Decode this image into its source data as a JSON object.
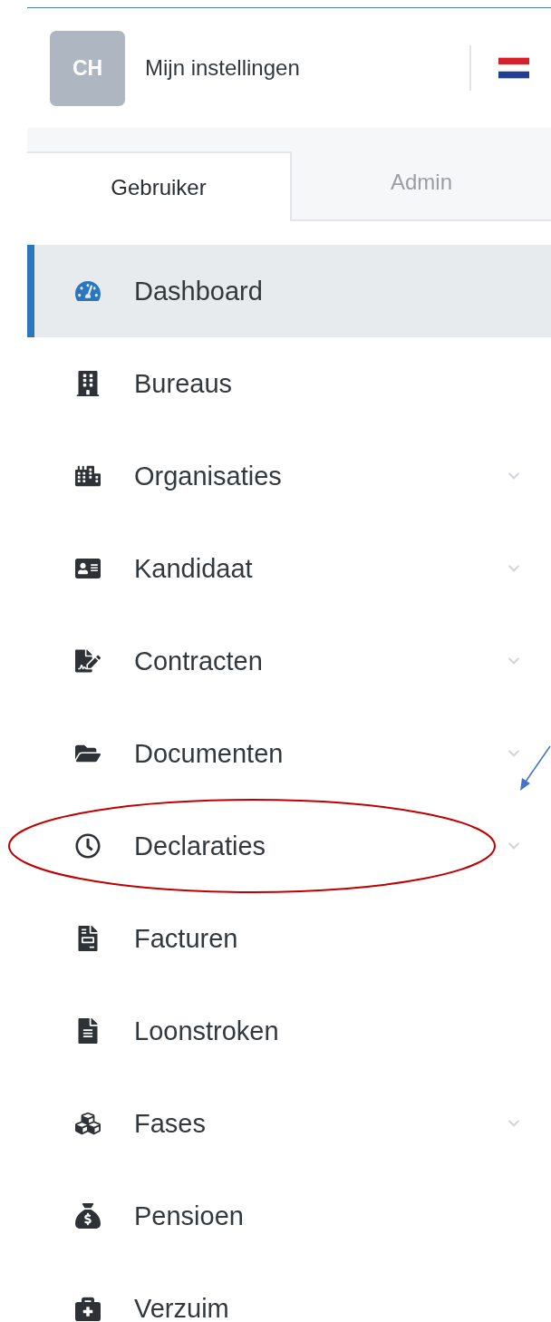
{
  "header": {
    "avatar": "CH",
    "title": "Mijn instellingen"
  },
  "tabs": [
    {
      "label": "Gebruiker",
      "selected": true
    },
    {
      "label": "Admin",
      "selected": false
    }
  ],
  "nav": [
    {
      "label": "Dashboard",
      "selected": true,
      "expandable": false,
      "circled": false
    },
    {
      "label": "Bureaus",
      "selected": false,
      "expandable": false,
      "circled": false
    },
    {
      "label": "Organisaties",
      "selected": false,
      "expandable": true,
      "circled": false
    },
    {
      "label": "Kandidaat",
      "selected": false,
      "expandable": true,
      "circled": false
    },
    {
      "label": "Contracten",
      "selected": false,
      "expandable": true,
      "circled": false
    },
    {
      "label": "Documenten",
      "selected": false,
      "expandable": true,
      "circled": false
    },
    {
      "label": "Declaraties",
      "selected": false,
      "expandable": true,
      "circled": true
    },
    {
      "label": "Facturen",
      "selected": false,
      "expandable": false,
      "circled": false
    },
    {
      "label": "Loonstroken",
      "selected": false,
      "expandable": false,
      "circled": false
    },
    {
      "label": "Fases",
      "selected": false,
      "expandable": true,
      "circled": false
    },
    {
      "label": "Pensioen",
      "selected": false,
      "expandable": false,
      "circled": false
    },
    {
      "label": "Verzuim",
      "selected": false,
      "expandable": false,
      "circled": false
    }
  ]
}
